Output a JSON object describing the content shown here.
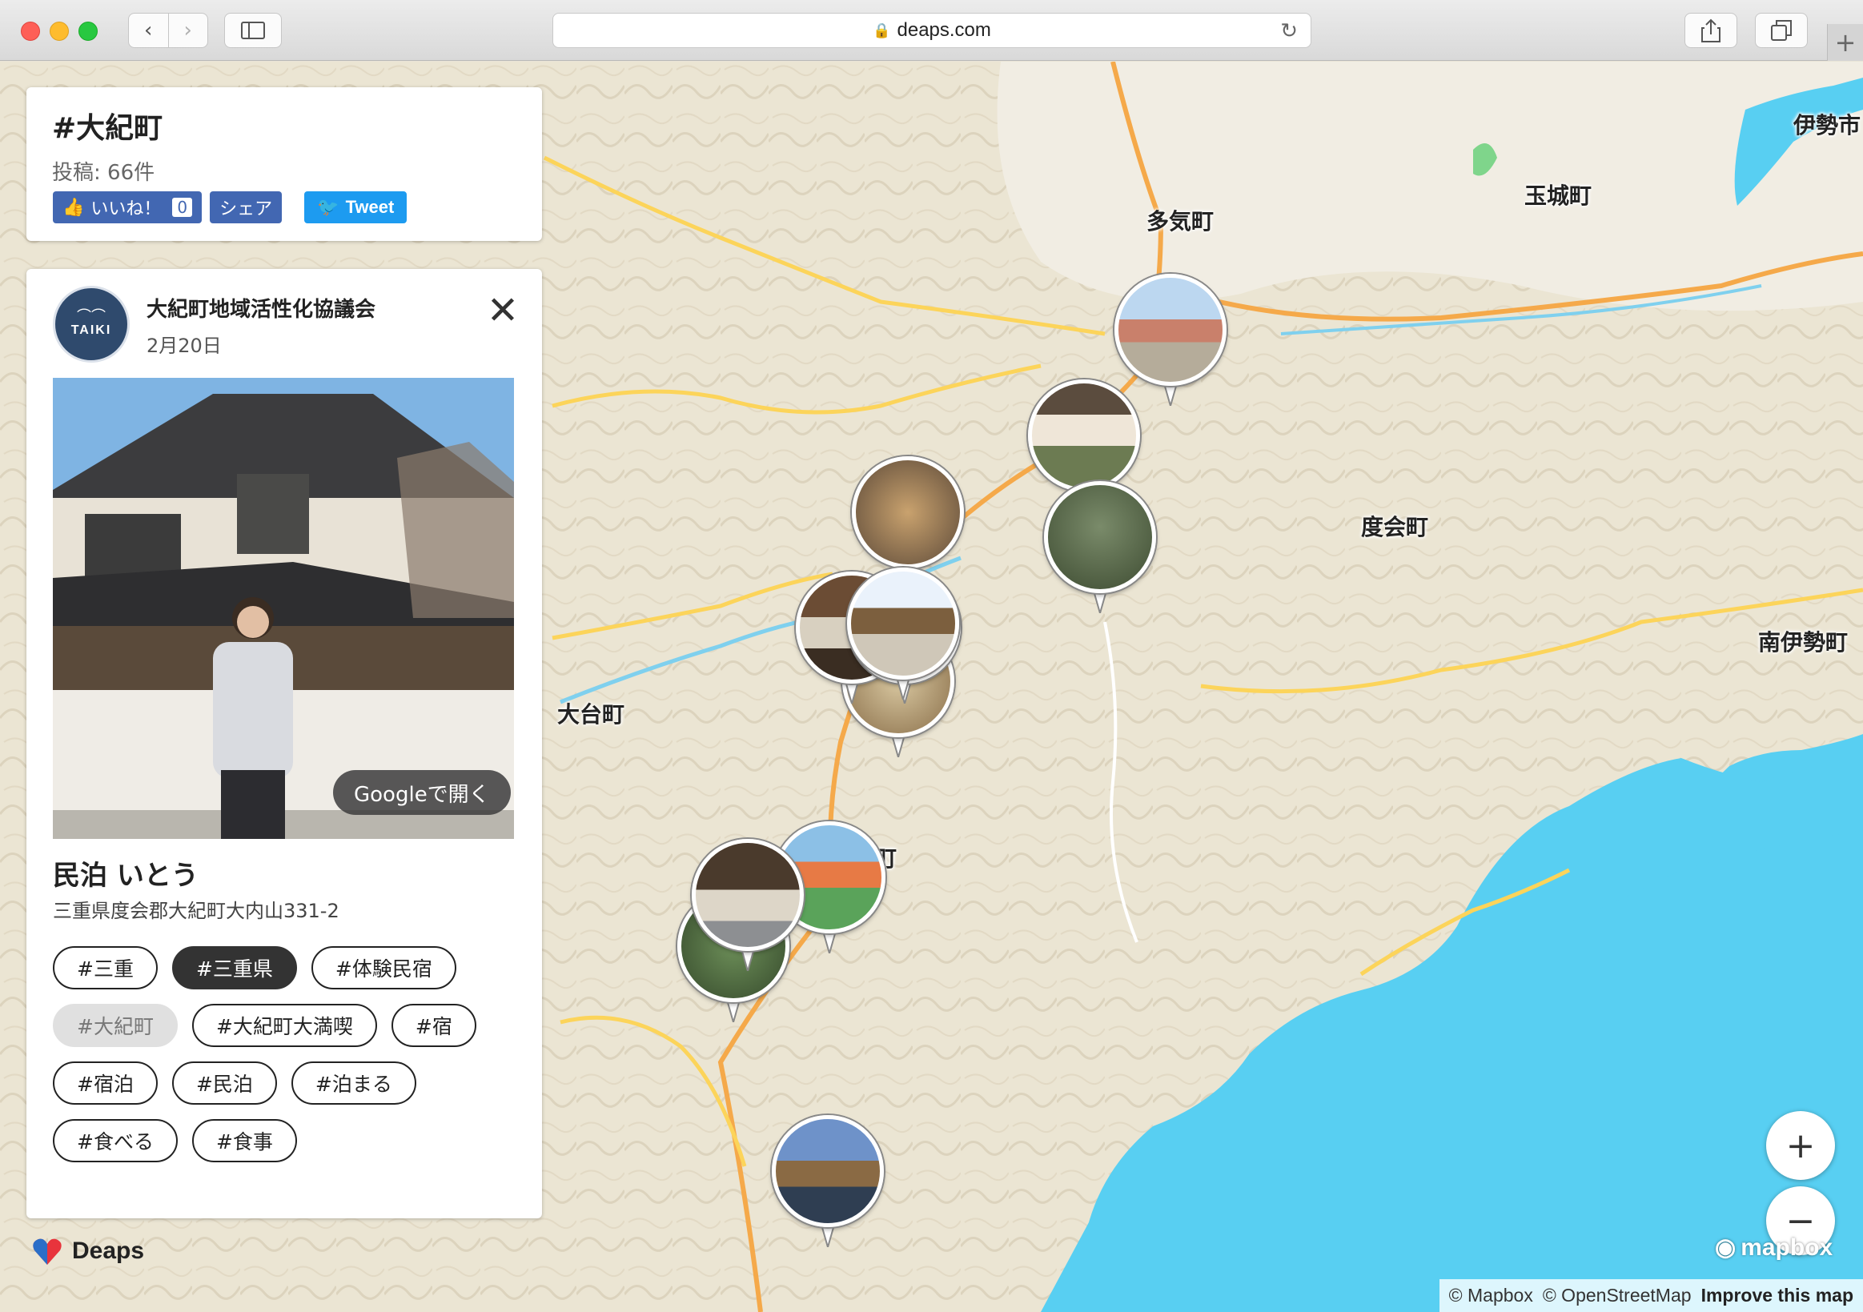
{
  "browser": {
    "url": "deaps.com",
    "icons": [
      "back-icon",
      "forward-icon",
      "sidebar-icon",
      "lock-icon",
      "reload-icon",
      "share-icon",
      "tabs-icon",
      "new-tab-icon"
    ]
  },
  "tag_panel": {
    "title": "#大紀町",
    "count": "投稿: 66件",
    "like_label": "いいね！",
    "like_count": "0",
    "share_label": "シェア",
    "tweet_label": "Tweet"
  },
  "post": {
    "author": "大紀町地域活性化協議会",
    "date": "2月20日",
    "avatar_text": "TAIKI",
    "google_open": "Googleで開く",
    "spot_name": "民泊 いとう",
    "address": "三重県度会郡大紀町大内山331-2",
    "tags": [
      {
        "label": "#三重",
        "state": "normal"
      },
      {
        "label": "#三重県",
        "state": "active"
      },
      {
        "label": "#体験民宿",
        "state": "normal"
      },
      {
        "label": "#大紀町",
        "state": "current"
      },
      {
        "label": "#大紀町大満喫",
        "state": "normal"
      },
      {
        "label": "#宿",
        "state": "normal"
      },
      {
        "label": "#宿泊",
        "state": "normal"
      },
      {
        "label": "#民泊",
        "state": "normal"
      },
      {
        "label": "#泊まる",
        "state": "normal"
      },
      {
        "label": "#食べる",
        "state": "normal"
      },
      {
        "label": "#食事",
        "state": "normal"
      }
    ]
  },
  "map": {
    "places": [
      "伊勢市",
      "玉城町",
      "多気町",
      "度会町",
      "南伊勢町",
      "大台町",
      "大紀町"
    ],
    "zoom_in": "+",
    "zoom_out": "−",
    "water_color": "#58cff2",
    "land_color": "#ebe5d3"
  },
  "brand": {
    "name": "Deaps",
    "mapbox": "mapbox"
  },
  "attribution": {
    "mapbox": "© Mapbox",
    "osm": "© OpenStreetMap",
    "improve": "Improve this map"
  }
}
